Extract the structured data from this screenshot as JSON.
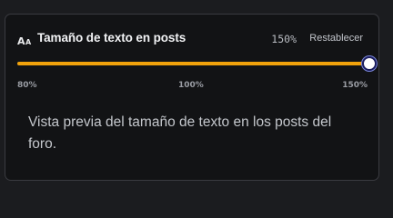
{
  "settings": {
    "icon": "text-size-icon",
    "icon_text": {
      "big": "A",
      "small": "A"
    },
    "title": "Tamaño de texto en posts",
    "current_value": "150%",
    "reset_label": "Restablecer",
    "slider": {
      "min": 80,
      "max": 150,
      "value": 150,
      "tick_labels": {
        "min": "80%",
        "mid": "100%",
        "max": "150%"
      }
    },
    "preview_text": "Vista previa del tamaño de texto en los posts del foro."
  },
  "colors": {
    "accent": "#f0a20c",
    "panel_bg": "#121315",
    "page_bg": "#1b1c1f",
    "text": "#c4c7cc"
  }
}
